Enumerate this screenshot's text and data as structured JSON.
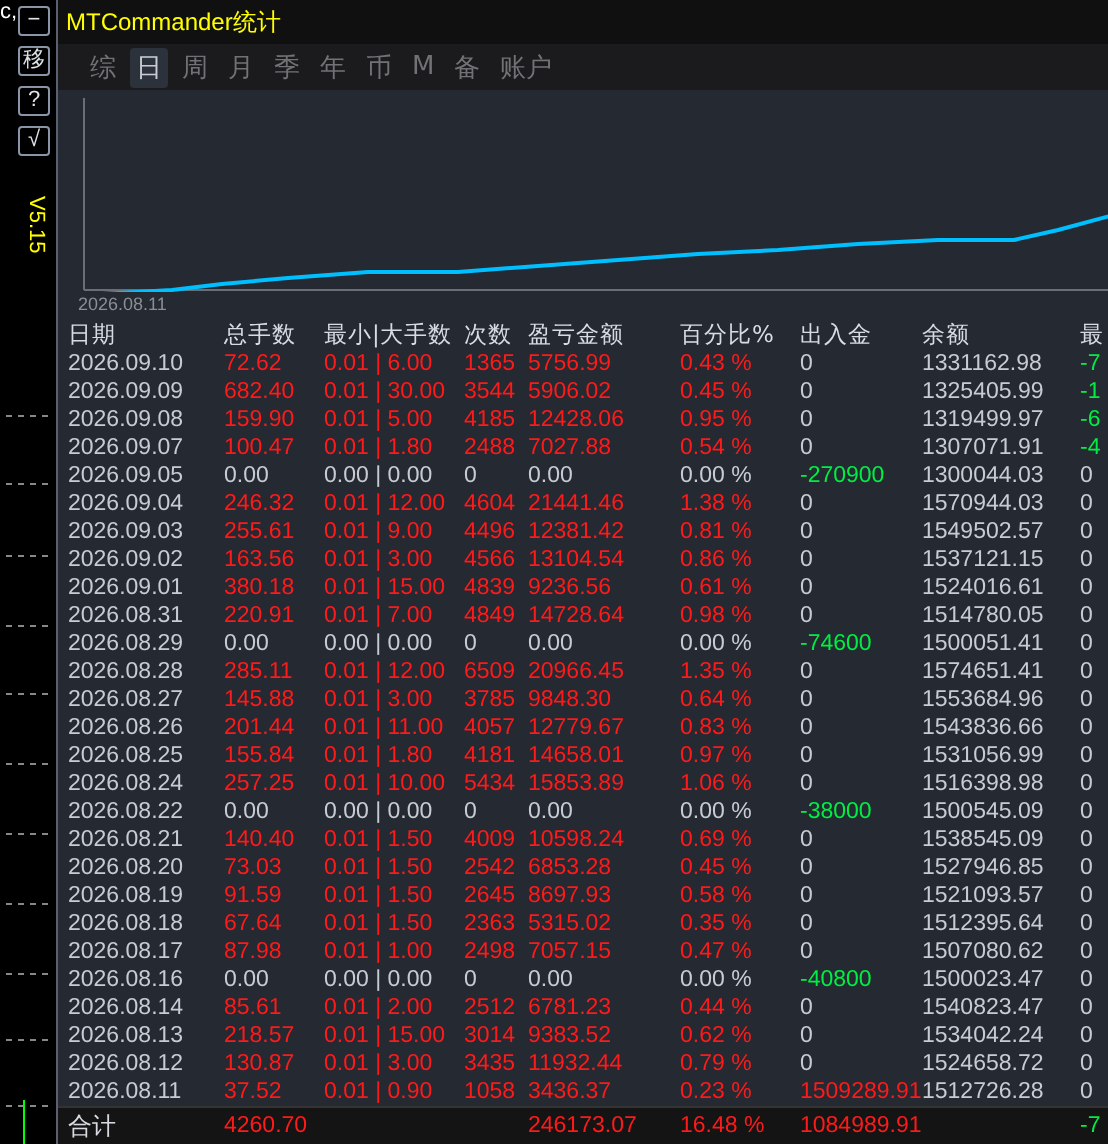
{
  "side": {
    "corner_text": "c,",
    "buttons": [
      "−",
      "移",
      "?",
      "√"
    ],
    "version": "V5.15"
  },
  "window": {
    "title": "MTCommander统计"
  },
  "tabs": [
    {
      "label": "综",
      "selected": false
    },
    {
      "label": "日",
      "selected": true
    },
    {
      "label": "周",
      "selected": false
    },
    {
      "label": "月",
      "selected": false
    },
    {
      "label": "季",
      "selected": false
    },
    {
      "label": "年",
      "selected": false
    },
    {
      "label": "币",
      "selected": false
    },
    {
      "label": "M",
      "selected": false
    },
    {
      "label": "备",
      "selected": false
    },
    {
      "label": "账户",
      "selected": false
    }
  ],
  "chart": {
    "x_label": "2026.08.11"
  },
  "table": {
    "columns": [
      "日期",
      "总手数",
      "最小|大手数",
      "次数",
      "盈亏金额",
      "百分比%",
      "出入金",
      "余额",
      "最"
    ],
    "rows": [
      {
        "kind": "up",
        "cells": [
          "2026.09.10",
          "72.62",
          "0.01 | 6.00",
          "1365",
          "5756.99",
          "0.43 %",
          {
            "text": "0",
            "kind": "flat"
          },
          "1331162.98",
          {
            "text": "-7",
            "kind": "down"
          }
        ]
      },
      {
        "kind": "up",
        "cells": [
          "2026.09.09",
          "682.40",
          "0.01 | 30.00",
          "3544",
          "5906.02",
          "0.45 %",
          {
            "text": "0",
            "kind": "flat"
          },
          "1325405.99",
          {
            "text": "-1",
            "kind": "down"
          }
        ]
      },
      {
        "kind": "up",
        "cells": [
          "2026.09.08",
          "159.90",
          "0.01 | 5.00",
          "4185",
          "12428.06",
          "0.95 %",
          {
            "text": "0",
            "kind": "flat"
          },
          "1319499.97",
          {
            "text": "-6",
            "kind": "down"
          }
        ]
      },
      {
        "kind": "up",
        "cells": [
          "2026.09.07",
          "100.47",
          "0.01 | 1.80",
          "2488",
          "7027.88",
          "0.54 %",
          {
            "text": "0",
            "kind": "flat"
          },
          "1307071.91",
          {
            "text": "-4",
            "kind": "down"
          }
        ]
      },
      {
        "kind": "flat",
        "cells": [
          "2026.09.05",
          "0.00",
          "0.00 | 0.00",
          "0",
          "0.00",
          "0.00 %",
          {
            "text": "-270900",
            "kind": "down"
          },
          "1300044.03",
          {
            "text": "0",
            "kind": "flat"
          }
        ]
      },
      {
        "kind": "up",
        "cells": [
          "2026.09.04",
          "246.32",
          "0.01 | 12.00",
          "4604",
          "21441.46",
          "1.38 %",
          {
            "text": "0",
            "kind": "flat"
          },
          "1570944.03",
          {
            "text": "0",
            "kind": "flat"
          }
        ]
      },
      {
        "kind": "up",
        "cells": [
          "2026.09.03",
          "255.61",
          "0.01 | 9.00",
          "4496",
          "12381.42",
          "0.81 %",
          {
            "text": "0",
            "kind": "flat"
          },
          "1549502.57",
          {
            "text": "0",
            "kind": "flat"
          }
        ]
      },
      {
        "kind": "up",
        "cells": [
          "2026.09.02",
          "163.56",
          "0.01 | 3.00",
          "4566",
          "13104.54",
          "0.86 %",
          {
            "text": "0",
            "kind": "flat"
          },
          "1537121.15",
          {
            "text": "0",
            "kind": "flat"
          }
        ]
      },
      {
        "kind": "up",
        "cells": [
          "2026.09.01",
          "380.18",
          "0.01 | 15.00",
          "4839",
          "9236.56",
          "0.61 %",
          {
            "text": "0",
            "kind": "flat"
          },
          "1524016.61",
          {
            "text": "0",
            "kind": "flat"
          }
        ]
      },
      {
        "kind": "up",
        "cells": [
          "2026.08.31",
          "220.91",
          "0.01 | 7.00",
          "4849",
          "14728.64",
          "0.98 %",
          {
            "text": "0",
            "kind": "flat"
          },
          "1514780.05",
          {
            "text": "0",
            "kind": "flat"
          }
        ]
      },
      {
        "kind": "flat",
        "cells": [
          "2026.08.29",
          "0.00",
          "0.00 | 0.00",
          "0",
          "0.00",
          "0.00 %",
          {
            "text": "-74600",
            "kind": "down"
          },
          "1500051.41",
          {
            "text": "0",
            "kind": "flat"
          }
        ]
      },
      {
        "kind": "up",
        "cells": [
          "2026.08.28",
          "285.11",
          "0.01 | 12.00",
          "6509",
          "20966.45",
          "1.35 %",
          {
            "text": "0",
            "kind": "flat"
          },
          "1574651.41",
          {
            "text": "0",
            "kind": "flat"
          }
        ]
      },
      {
        "kind": "up",
        "cells": [
          "2026.08.27",
          "145.88",
          "0.01 | 3.00",
          "3785",
          "9848.30",
          "0.64 %",
          {
            "text": "0",
            "kind": "flat"
          },
          "1553684.96",
          {
            "text": "0",
            "kind": "flat"
          }
        ]
      },
      {
        "kind": "up",
        "cells": [
          "2026.08.26",
          "201.44",
          "0.01 | 11.00",
          "4057",
          "12779.67",
          "0.83 %",
          {
            "text": "0",
            "kind": "flat"
          },
          "1543836.66",
          {
            "text": "0",
            "kind": "flat"
          }
        ]
      },
      {
        "kind": "up",
        "cells": [
          "2026.08.25",
          "155.84",
          "0.01 | 1.80",
          "4181",
          "14658.01",
          "0.97 %",
          {
            "text": "0",
            "kind": "flat"
          },
          "1531056.99",
          {
            "text": "0",
            "kind": "flat"
          }
        ]
      },
      {
        "kind": "up",
        "cells": [
          "2026.08.24",
          "257.25",
          "0.01 | 10.00",
          "5434",
          "15853.89",
          "1.06 %",
          {
            "text": "0",
            "kind": "flat"
          },
          "1516398.98",
          {
            "text": "0",
            "kind": "flat"
          }
        ]
      },
      {
        "kind": "flat",
        "cells": [
          "2026.08.22",
          "0.00",
          "0.00 | 0.00",
          "0",
          "0.00",
          "0.00 %",
          {
            "text": "-38000",
            "kind": "down"
          },
          "1500545.09",
          {
            "text": "0",
            "kind": "flat"
          }
        ]
      },
      {
        "kind": "up",
        "cells": [
          "2026.08.21",
          "140.40",
          "0.01 | 1.50",
          "4009",
          "10598.24",
          "0.69 %",
          {
            "text": "0",
            "kind": "flat"
          },
          "1538545.09",
          {
            "text": "0",
            "kind": "flat"
          }
        ]
      },
      {
        "kind": "up",
        "cells": [
          "2026.08.20",
          "73.03",
          "0.01 | 1.50",
          "2542",
          "6853.28",
          "0.45 %",
          {
            "text": "0",
            "kind": "flat"
          },
          "1527946.85",
          {
            "text": "0",
            "kind": "flat"
          }
        ]
      },
      {
        "kind": "up",
        "cells": [
          "2026.08.19",
          "91.59",
          "0.01 | 1.50",
          "2645",
          "8697.93",
          "0.58 %",
          {
            "text": "0",
            "kind": "flat"
          },
          "1521093.57",
          {
            "text": "0",
            "kind": "flat"
          }
        ]
      },
      {
        "kind": "up",
        "cells": [
          "2026.08.18",
          "67.64",
          "0.01 | 1.50",
          "2363",
          "5315.02",
          "0.35 %",
          {
            "text": "0",
            "kind": "flat"
          },
          "1512395.64",
          {
            "text": "0",
            "kind": "flat"
          }
        ]
      },
      {
        "kind": "up",
        "cells": [
          "2026.08.17",
          "87.98",
          "0.01 | 1.00",
          "2498",
          "7057.15",
          "0.47 %",
          {
            "text": "0",
            "kind": "flat"
          },
          "1507080.62",
          {
            "text": "0",
            "kind": "flat"
          }
        ]
      },
      {
        "kind": "flat",
        "cells": [
          "2026.08.16",
          "0.00",
          "0.00 | 0.00",
          "0",
          "0.00",
          "0.00 %",
          {
            "text": "-40800",
            "kind": "down"
          },
          "1500023.47",
          {
            "text": "0",
            "kind": "flat"
          }
        ]
      },
      {
        "kind": "up",
        "cells": [
          "2026.08.14",
          "85.61",
          "0.01 | 2.00",
          "2512",
          "6781.23",
          "0.44 %",
          {
            "text": "0",
            "kind": "flat"
          },
          "1540823.47",
          {
            "text": "0",
            "kind": "flat"
          }
        ]
      },
      {
        "kind": "up",
        "cells": [
          "2026.08.13",
          "218.57",
          "0.01 | 15.00",
          "3014",
          "9383.52",
          "0.62 %",
          {
            "text": "0",
            "kind": "flat"
          },
          "1534042.24",
          {
            "text": "0",
            "kind": "flat"
          }
        ]
      },
      {
        "kind": "up",
        "cells": [
          "2026.08.12",
          "130.87",
          "0.01 | 3.00",
          "3435",
          "11932.44",
          "0.79 %",
          {
            "text": "0",
            "kind": "flat"
          },
          "1524658.72",
          {
            "text": "0",
            "kind": "flat"
          }
        ]
      },
      {
        "kind": "up",
        "cells": [
          "2026.08.11",
          "37.52",
          "0.01 | 0.90",
          "1058",
          "3436.37",
          "0.23 %",
          {
            "text": "1509289.91",
            "kind": "up"
          },
          "1512726.28",
          {
            "text": "0",
            "kind": "flat"
          }
        ]
      }
    ],
    "total": {
      "label": "合计",
      "lots": "4260.70",
      "pnl": "246173.07",
      "pct": "16.48 %",
      "flow": "1084989.91",
      "col_9": "-7"
    }
  }
}
